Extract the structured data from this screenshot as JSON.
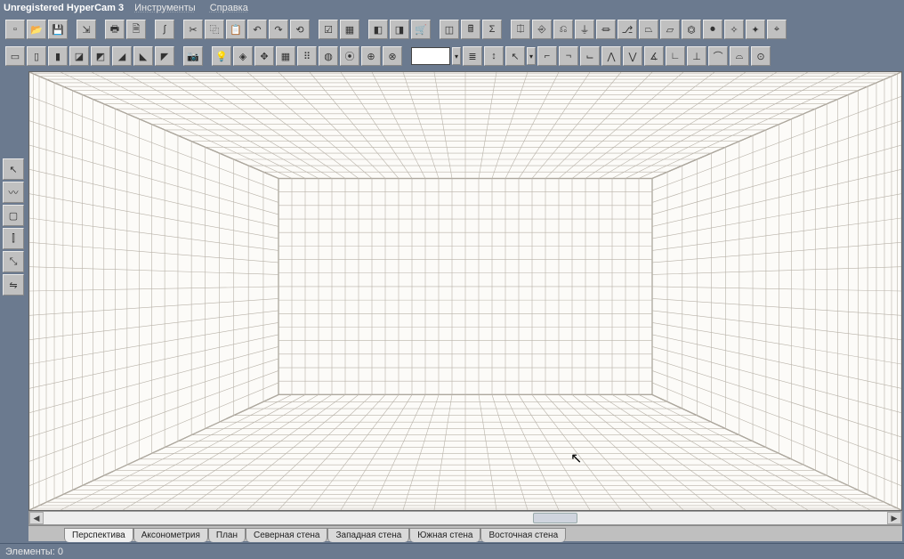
{
  "app": {
    "title": "Unregistered HyperCam 3"
  },
  "menu": {
    "tools": "Инструменты",
    "help": "Справка"
  },
  "toolbar1_icons": [
    "new-file",
    "open-file",
    "save-file",
    "save-as",
    "print",
    "print-preview",
    "script",
    "cut",
    "copy",
    "paste",
    "undo",
    "redo",
    "redo-all",
    "opts",
    "window-opts",
    "toggle-a",
    "toggle-b",
    "toggle-store",
    "cube-a",
    "calc",
    "sigma",
    "mod-1",
    "mod-2",
    "mod-3",
    "mod-4",
    "mod-5",
    "mod-6",
    "mod-7",
    "mod-8",
    "mod-9",
    "mod-10",
    "mod-11",
    "mod-12",
    "mod-13"
  ],
  "toolbar2_icons": [
    "view-box-1",
    "view-box-2",
    "view-box-3",
    "view-box-4",
    "view-box-5",
    "view-angle-1",
    "view-angle-2",
    "view-angle-3",
    "cam",
    "bulb",
    "tag",
    "arrows",
    "grid-toggle",
    "grid-dot",
    "globe-1",
    "globe-wire",
    "target-1",
    "target-2",
    "color-swatch",
    "dropdown",
    "layers",
    "pick-1",
    "pick-arrow",
    "dropdown",
    "snap-1",
    "snap-2",
    "snap-3",
    "snap-4",
    "snap-5",
    "snap-6",
    "snap-7",
    "snap-8",
    "snap-9",
    "snap-10",
    "target-3"
  ],
  "left_tools": [
    "cursor",
    "curve-tool",
    "rect-tool",
    "wall-tool",
    "scale-tool",
    "mirror-tool"
  ],
  "color_swatch": "#ffffff",
  "tabs": [
    {
      "id": "perspective",
      "label": "Перспектива",
      "active": true
    },
    {
      "id": "axonometry",
      "label": "Аксонометрия",
      "active": false
    },
    {
      "id": "plan",
      "label": "План",
      "active": false
    },
    {
      "id": "north",
      "label": "Северная стена",
      "active": false
    },
    {
      "id": "west",
      "label": "Западная стена",
      "active": false
    },
    {
      "id": "south",
      "label": "Южная стена",
      "active": false
    },
    {
      "id": "east",
      "label": "Восточная стена",
      "active": false
    }
  ],
  "status": {
    "elements_label": "Элементы:",
    "elements_count": "0"
  }
}
